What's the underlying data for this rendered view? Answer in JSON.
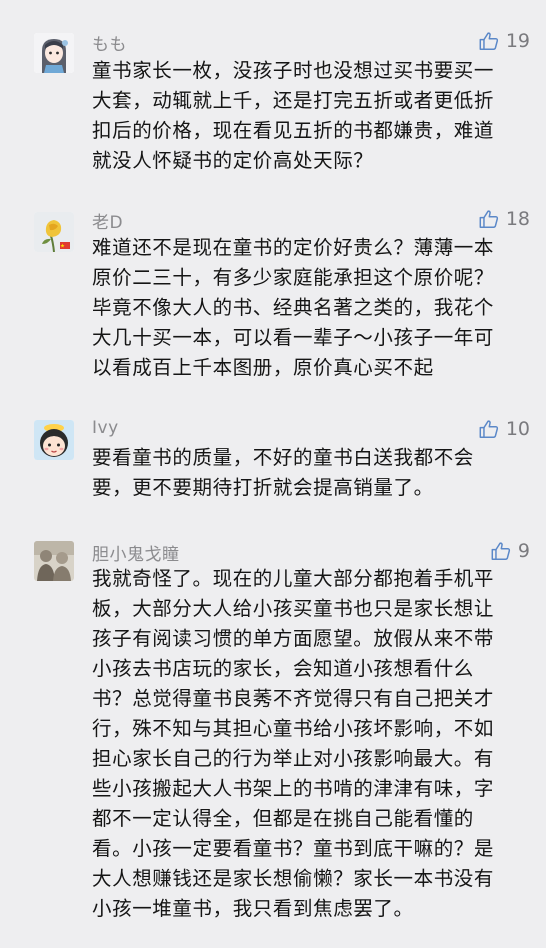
{
  "comments": [
    {
      "name": "もも",
      "likes": "19",
      "avatar_icon": "anime-girl-avatar-icon",
      "lines": [
        "童书家长一枚，没孩子时也没想过买书要买一",
        "大套，动辄就上千，还是打完五折或者更低折",
        "扣后的价格，现在看见五折的书都嫌贵，难道",
        "就没人怀疑书的定价高处天际？"
      ]
    },
    {
      "name": "老D",
      "likes": "18",
      "avatar_icon": "yellow-flower-avatar-icon",
      "lines": [
        "难道还不是现在童书的定价好贵么？薄薄一本",
        "原价二三十，有多少家庭能承担这个原价呢？",
        "毕竟不像大人的书、经典名著之类的，我花个",
        "大几十买一本，可以看一辈子～小孩子一年可",
        "以看成百上千本图册，原价真心买不起"
      ]
    },
    {
      "name": "Ivy",
      "likes": "10",
      "avatar_icon": "cartoon-girl-avatar-icon",
      "lines": [
        "要看童书的质量，不好的童书白送我都不会",
        "要，更不要期待打折就会提高销量了。"
      ]
    },
    {
      "name": "胆小鬼戈瞳",
      "likes": "9",
      "avatar_icon": "photo-avatar-icon",
      "lines": [
        "我就奇怪了。现在的儿童大部分都抱着手机平",
        "板，大部分大人给小孩买童书也只是家长想让",
        "孩子有阅读习惯的单方面愿望。放假从来不带",
        "小孩去书店玩的家长，会知道小孩想看什么",
        "书？总觉得童书良莠不齐觉得只有自己把关才",
        "行，殊不知与其担心童书给小孩坏影响，不如",
        "担心家长自己的行为举止对小孩影响最大。有",
        "些小孩搬起大人书架上的书啃的津津有味，字",
        "都不一定认得全，但都是在挑自己能看懂的",
        "看。小孩一定要看童书？童书到底干嘛的？是",
        "大人想赚钱还是家长想偷懒？家长一本书没有",
        "小孩一堆童书，我只看到焦虑罢了。"
      ]
    }
  ]
}
